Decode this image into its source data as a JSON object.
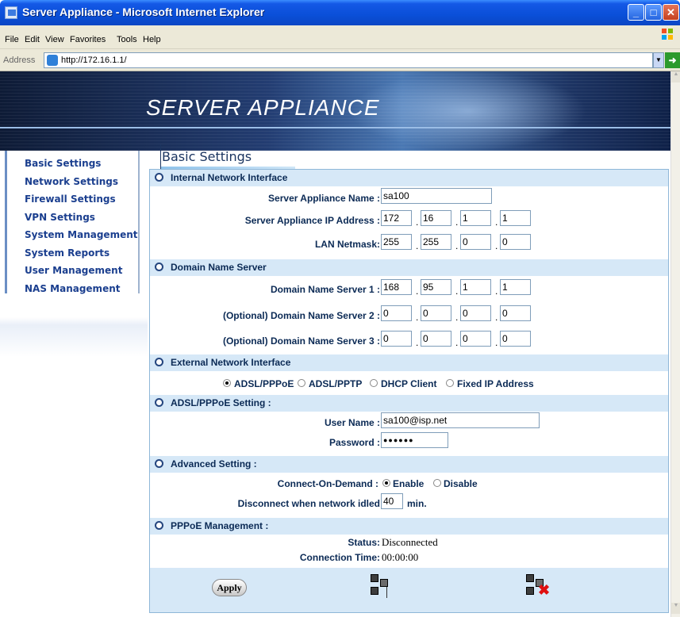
{
  "window": {
    "title": "Server Appliance - Microsoft Internet Explorer"
  },
  "menu": [
    "File",
    "Edit",
    "View",
    "Favorites",
    "Tools",
    "Help"
  ],
  "address": {
    "label": "Address",
    "url": "http://172.16.1.1/",
    "go": "Go"
  },
  "banner": {
    "brand": "SERVER APPLIANCE"
  },
  "sidebar": {
    "items": [
      "Basic Settings",
      "Network Settings",
      "Firewall Settings",
      "VPN Settings",
      "System Management",
      "System Reports",
      "User Management",
      "NAS Management"
    ]
  },
  "page": {
    "heading": "Basic Settings"
  },
  "internal": {
    "header": "Internal Network Interface",
    "name_label": "Server Appliance Name :",
    "name_value": "sa100",
    "ip_label": "Server Appliance IP Address :",
    "ip": [
      "172",
      "16",
      "1",
      "1"
    ],
    "mask_label": "LAN Netmask:",
    "mask": [
      "255",
      "255",
      "0",
      "0"
    ]
  },
  "dns": {
    "header": "Domain Name Server",
    "dns1_label": "Domain Name Server 1 :",
    "dns1": [
      "168",
      "95",
      "1",
      "1"
    ],
    "dns2_label": "(Optional) Domain Name Server 2 :",
    "dns2": [
      "0",
      "0",
      "0",
      "0"
    ],
    "dns3_label": "(Optional) Domain Name Server 3 :",
    "dns3": [
      "0",
      "0",
      "0",
      "0"
    ]
  },
  "external": {
    "header": "External Network Interface",
    "options": [
      "ADSL/PPPoE",
      "ADSL/PPTP",
      "DHCP Client",
      "Fixed IP Address"
    ],
    "selected": "ADSL/PPPoE"
  },
  "pppoe": {
    "header": "ADSL/PPPoE Setting :",
    "user_label": "User Name :",
    "user_value": "sa100@isp.net",
    "pass_label": "Password :",
    "pass_value": "●●●●●●"
  },
  "advanced": {
    "header": "Advanced Setting :",
    "cod_label": "Connect-On-Demand :",
    "enable": "Enable",
    "disable": "Disable",
    "selected": "Enable",
    "idle_label": "Disconnect when network idled",
    "idle_value": "40",
    "idle_unit": "min."
  },
  "mgmt": {
    "header": "PPPoE Management :",
    "status_label": "Status:",
    "status_value": "Disconnected",
    "time_label": "Connection Time:",
    "time_value": "00:00:00"
  },
  "buttons": {
    "apply": "Apply"
  }
}
